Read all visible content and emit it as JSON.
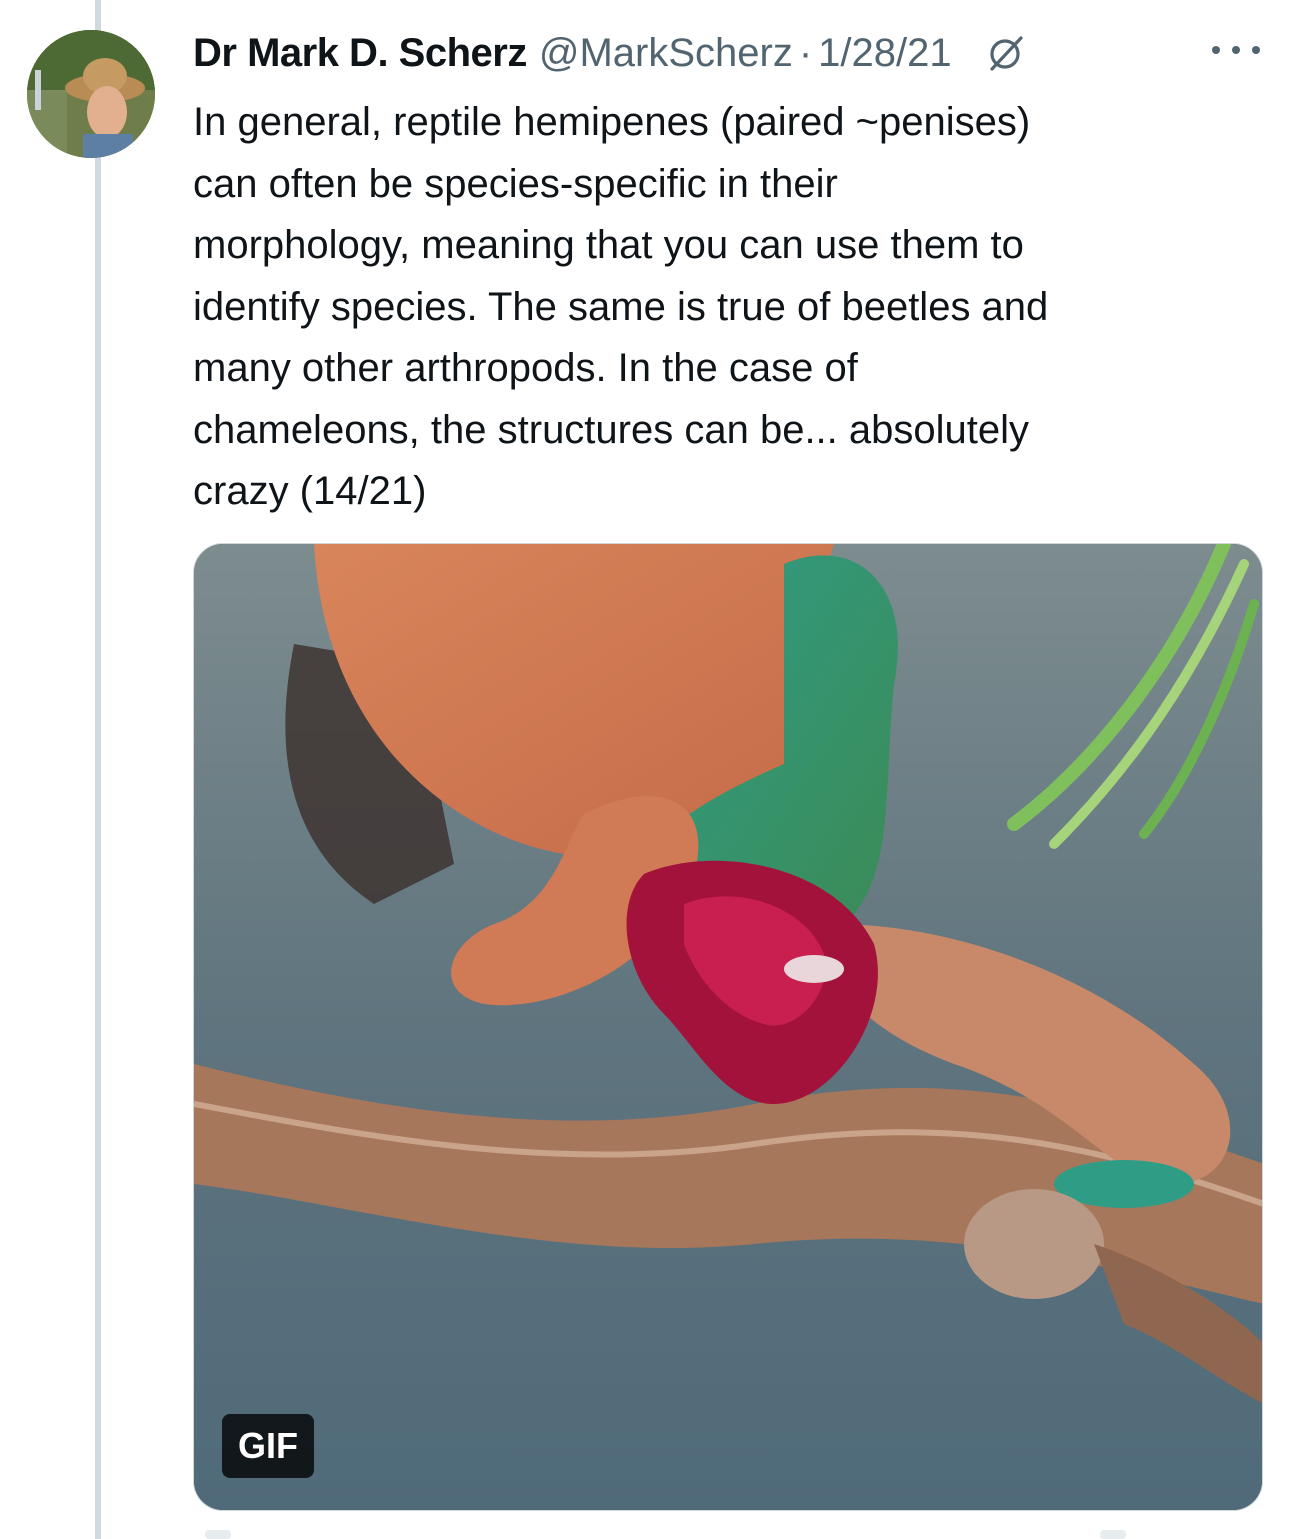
{
  "tweet": {
    "author_name": "Dr Mark D. Scherz",
    "author_handle": "@MarkScherz",
    "separator": "·",
    "date": "1/28/21",
    "text_lines": [
      "In general, reptile hemipenes (paired ~penises)",
      "can often be species-specific in their",
      "morphology, meaning that you can use them to",
      "identify species. The same is true of beetles and",
      "many other arthropods. In the case of",
      "chameleons, the structures can be... absolutely",
      "crazy (14/21)"
    ],
    "media": {
      "badge": "GIF"
    }
  },
  "icons": {
    "grok": "grok-icon",
    "more": "more-options-icon",
    "avatar": "avatar"
  },
  "colors": {
    "text_primary": "#0f1419",
    "text_secondary": "#536471",
    "thread_line": "#cfd9de",
    "gif_badge_bg": "#000000"
  }
}
